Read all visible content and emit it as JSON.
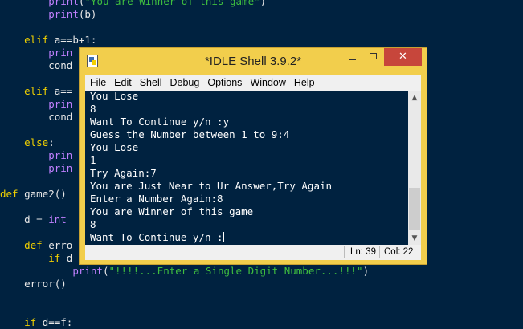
{
  "editor": {
    "lines": [
      {
        "pre": "        ",
        "parts": [
          {
            "t": "print",
            "c": "bi"
          },
          {
            "t": "(",
            "c": ""
          },
          {
            "t": "\"You are Winner of this game\"",
            "c": "str"
          },
          {
            "t": ")",
            "c": ""
          }
        ]
      },
      {
        "pre": "        ",
        "parts": [
          {
            "t": "print",
            "c": "bi"
          },
          {
            "t": "(b)",
            "c": ""
          }
        ]
      },
      {
        "pre": "",
        "parts": []
      },
      {
        "pre": "    ",
        "parts": [
          {
            "t": "elif",
            "c": "kw"
          },
          {
            "t": " a==b+1:",
            "c": ""
          }
        ]
      },
      {
        "pre": "        ",
        "parts": [
          {
            "t": "prin",
            "c": "bi"
          }
        ]
      },
      {
        "pre": "        ",
        "parts": [
          {
            "t": "cond",
            "c": ""
          }
        ]
      },
      {
        "pre": "",
        "parts": []
      },
      {
        "pre": "    ",
        "parts": [
          {
            "t": "elif",
            "c": "kw"
          },
          {
            "t": " a==",
            "c": ""
          }
        ]
      },
      {
        "pre": "        ",
        "parts": [
          {
            "t": "prin",
            "c": "bi"
          }
        ]
      },
      {
        "pre": "        ",
        "parts": [
          {
            "t": "cond",
            "c": ""
          }
        ]
      },
      {
        "pre": "",
        "parts": []
      },
      {
        "pre": "    ",
        "parts": [
          {
            "t": "else",
            "c": "kw"
          },
          {
            "t": ":",
            "c": ""
          }
        ]
      },
      {
        "pre": "        ",
        "parts": [
          {
            "t": "prin",
            "c": "bi"
          }
        ]
      },
      {
        "pre": "        ",
        "parts": [
          {
            "t": "prin",
            "c": "bi"
          }
        ]
      },
      {
        "pre": "",
        "parts": []
      },
      {
        "pre": "",
        "parts": [
          {
            "t": "def",
            "c": "kw"
          },
          {
            "t": " game2()",
            "c": ""
          }
        ]
      },
      {
        "pre": "",
        "parts": []
      },
      {
        "pre": "    ",
        "parts": [
          {
            "t": "d = ",
            "c": ""
          },
          {
            "t": "int",
            "c": "bi"
          }
        ]
      },
      {
        "pre": "",
        "parts": []
      },
      {
        "pre": "    ",
        "parts": [
          {
            "t": "def",
            "c": "kw"
          },
          {
            "t": " erro",
            "c": ""
          }
        ]
      },
      {
        "pre": "        ",
        "parts": [
          {
            "t": "if",
            "c": "kw"
          },
          {
            "t": " d",
            "c": ""
          }
        ]
      },
      {
        "pre": "            ",
        "parts": [
          {
            "t": "print",
            "c": "bi"
          },
          {
            "t": "(",
            "c": ""
          },
          {
            "t": "\"!!!!...Enter a Single Digit Number...!!!\"",
            "c": "str"
          },
          {
            "t": ")",
            "c": ""
          }
        ]
      },
      {
        "pre": "    ",
        "parts": [
          {
            "t": "error()",
            "c": ""
          }
        ]
      },
      {
        "pre": "",
        "parts": []
      },
      {
        "pre": "",
        "parts": []
      },
      {
        "pre": "    ",
        "parts": [
          {
            "t": "if",
            "c": "kw"
          },
          {
            "t": " d==f:",
            "c": ""
          }
        ]
      }
    ]
  },
  "window": {
    "title": "*IDLE Shell 3.9.2*",
    "close_glyph": "✕",
    "menu": [
      "File",
      "Edit",
      "Shell",
      "Debug",
      "Options",
      "Window",
      "Help"
    ]
  },
  "shell": {
    "lines": [
      "You Lose",
      "8",
      "Want To Continue y/n :y",
      "Guess the Number between 1 to 9:4",
      "You Lose",
      "1",
      "Try Again:7",
      "You are Just Near to Ur Answer,Try Again",
      "Enter a Number Again:8",
      "You are Winner of this game",
      "8",
      "Want To Continue y/n :"
    ]
  },
  "status": {
    "ln": "Ln: 39",
    "col": "Col: 22"
  },
  "scroll": {
    "up_glyph": "▲",
    "down_glyph": "▼"
  }
}
